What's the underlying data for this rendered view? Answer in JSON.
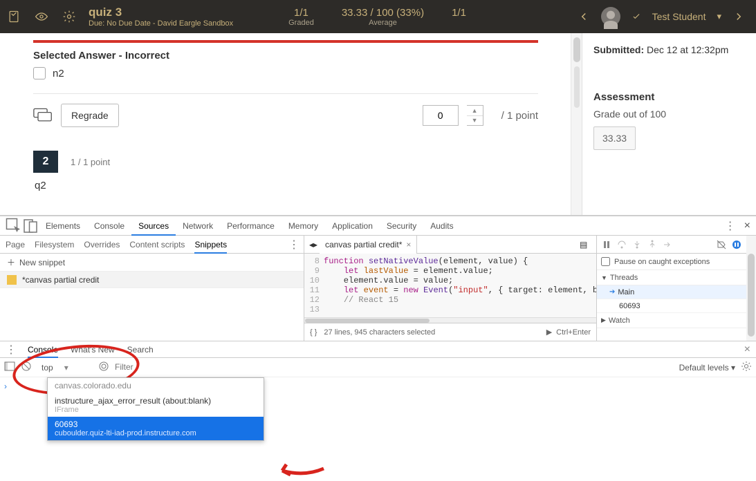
{
  "header": {
    "title": "quiz 3",
    "subtitle": "Due: No Due Date - David Eargle Sandbox",
    "stat_graded_val": "1/1",
    "stat_graded_lbl": "Graded",
    "stat_avg_val": "33.33 / 100 (33%)",
    "stat_avg_lbl": "Average",
    "stat_count_val": "1/1",
    "student_name": "Test Student"
  },
  "quiz": {
    "selected_answer_hdr": "Selected Answer - Incorrect",
    "answer_text": "n2",
    "regrade_label": "Regrade",
    "points_value": "0",
    "points_label": "/ 1 point",
    "q2_num": "2",
    "q2_points": "1 / 1 point",
    "q2_text": "q2"
  },
  "sidebar": {
    "submitted_label": "Submitted:",
    "submitted_val": "Dec 12 at 12:32pm",
    "assess_header": "Assessment",
    "grade_label": "Grade out of 100",
    "grade_value": "33.33"
  },
  "devtools": {
    "tabs": {
      "elements": "Elements",
      "console": "Console",
      "sources": "Sources",
      "network": "Network",
      "performance": "Performance",
      "memory": "Memory",
      "application": "Application",
      "security": "Security",
      "audits": "Audits"
    },
    "source_subtabs": {
      "page": "Page",
      "filesystem": "Filesystem",
      "overrides": "Overrides",
      "content": "Content scripts",
      "snippets": "Snippets"
    },
    "new_snippet": "New snippet",
    "snippet_file": "*canvas partial credit",
    "code_tab": "canvas partial credit*",
    "code_lines": {
      "l8": "8",
      "l9": "9",
      "l10": "10",
      "l11": "11",
      "l12": "12",
      "l13": "13"
    },
    "status": "27 lines, 945 characters selected",
    "run_label": "Ctrl+Enter",
    "right": {
      "pause_caught": "Pause on caught exceptions",
      "threads": "Threads",
      "main": "Main",
      "thread_id": "60693",
      "watch": "Watch"
    }
  },
  "console": {
    "tabs": {
      "console": "Console",
      "whatsnew": "What's New",
      "search": "Search"
    },
    "context": "top",
    "filter_placeholder": "Filter",
    "levels": "Default levels",
    "dropdown": {
      "row_header": "canvas.colorado.edu",
      "row_iframe": "instructure_ajax_error_result (about:blank)",
      "row_iframe_sub": "IFrame",
      "row_sel_top": "60693",
      "row_sel_sub": "cuboulder.quiz-lti-iad-prod.instructure.com"
    }
  }
}
